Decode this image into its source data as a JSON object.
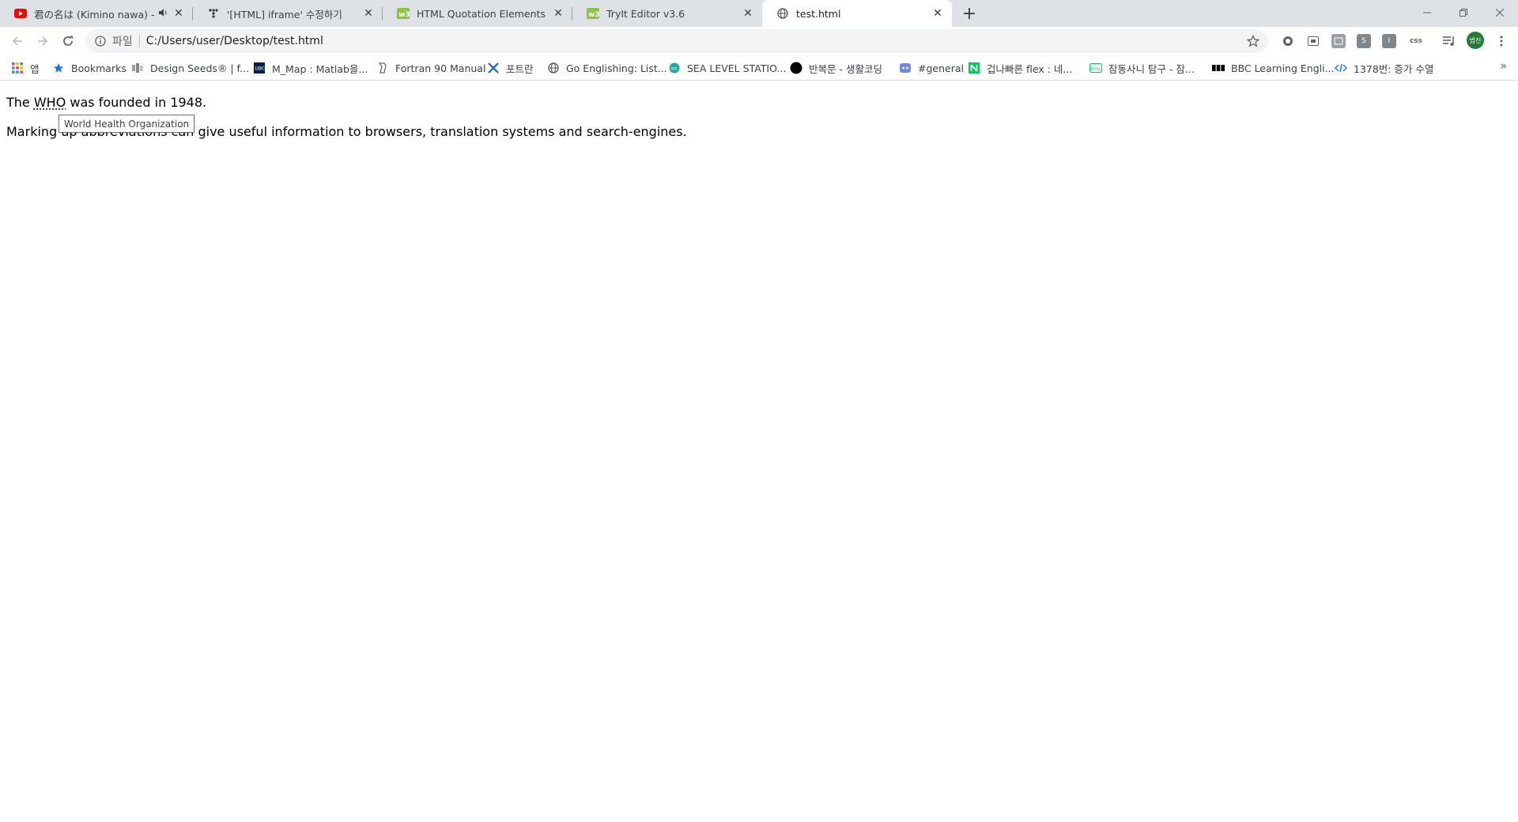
{
  "tabs": [
    {
      "title": "君の名は (Kimino nawa) - ",
      "icon": "youtube-icon",
      "audio": true
    },
    {
      "title": "'[HTML] iframe' 수정하기",
      "icon": "tistory-icon"
    },
    {
      "title": "HTML Quotation Elements",
      "icon": "w3schools-icon"
    },
    {
      "title": "TryIt Editor v3.6",
      "icon": "w3schools-icon"
    },
    {
      "title": "test.html",
      "icon": "globe-icon",
      "active": true
    }
  ],
  "toolbar": {
    "scheme_label": "파일",
    "url": "C:/Users/user/Desktop/test.html"
  },
  "extensions": {
    "css_label": "css",
    "s_label": "S",
    "i_label": "I",
    "profile_label": "범진"
  },
  "bookmarks": {
    "apps_label": "앱",
    "items": [
      {
        "label": "Bookmarks",
        "icon": "star-icon"
      },
      {
        "label": "Design Seeds® | f...",
        "icon": "design-seeds-icon"
      },
      {
        "label": "M_Map : Matlab을...",
        "icon": "ubc-icon"
      },
      {
        "label": "Fortran 90 Manual",
        "icon": "fortran-icon"
      },
      {
        "label": "포트란",
        "icon": "tools-icon"
      },
      {
        "label": "Go Englishing: List...",
        "icon": "globe-icon"
      },
      {
        "label": "SEA LEVEL STATIO...",
        "icon": "ioc-icon"
      },
      {
        "label": "반복문 - 생활코딩",
        "icon": "circle-icon"
      },
      {
        "label": "#general",
        "icon": "discord-icon"
      },
      {
        "label": "겁나빠른 flex : 네...",
        "icon": "naver-icon"
      },
      {
        "label": "잠동사니 탐구 - 잠...",
        "icon": "blog-icon"
      },
      {
        "label": "BBC Learning Engli...",
        "icon": "bbc-icon"
      },
      {
        "label": "1378번: 증가 수열",
        "icon": "code-icon"
      }
    ]
  },
  "page": {
    "line1_prefix": "The ",
    "abbr": "WHO",
    "line1_suffix": " was founded in 1948.",
    "line2": "Marking up abbreviations can give useful information to browsers, translation systems and search-engines.",
    "tooltip": "World Health Organization"
  },
  "colors": {
    "tabstrip": "#dee1e6",
    "accent_green": "#1e7e34",
    "youtube_red": "#ff0000",
    "w3_green": "#8bc34a"
  }
}
